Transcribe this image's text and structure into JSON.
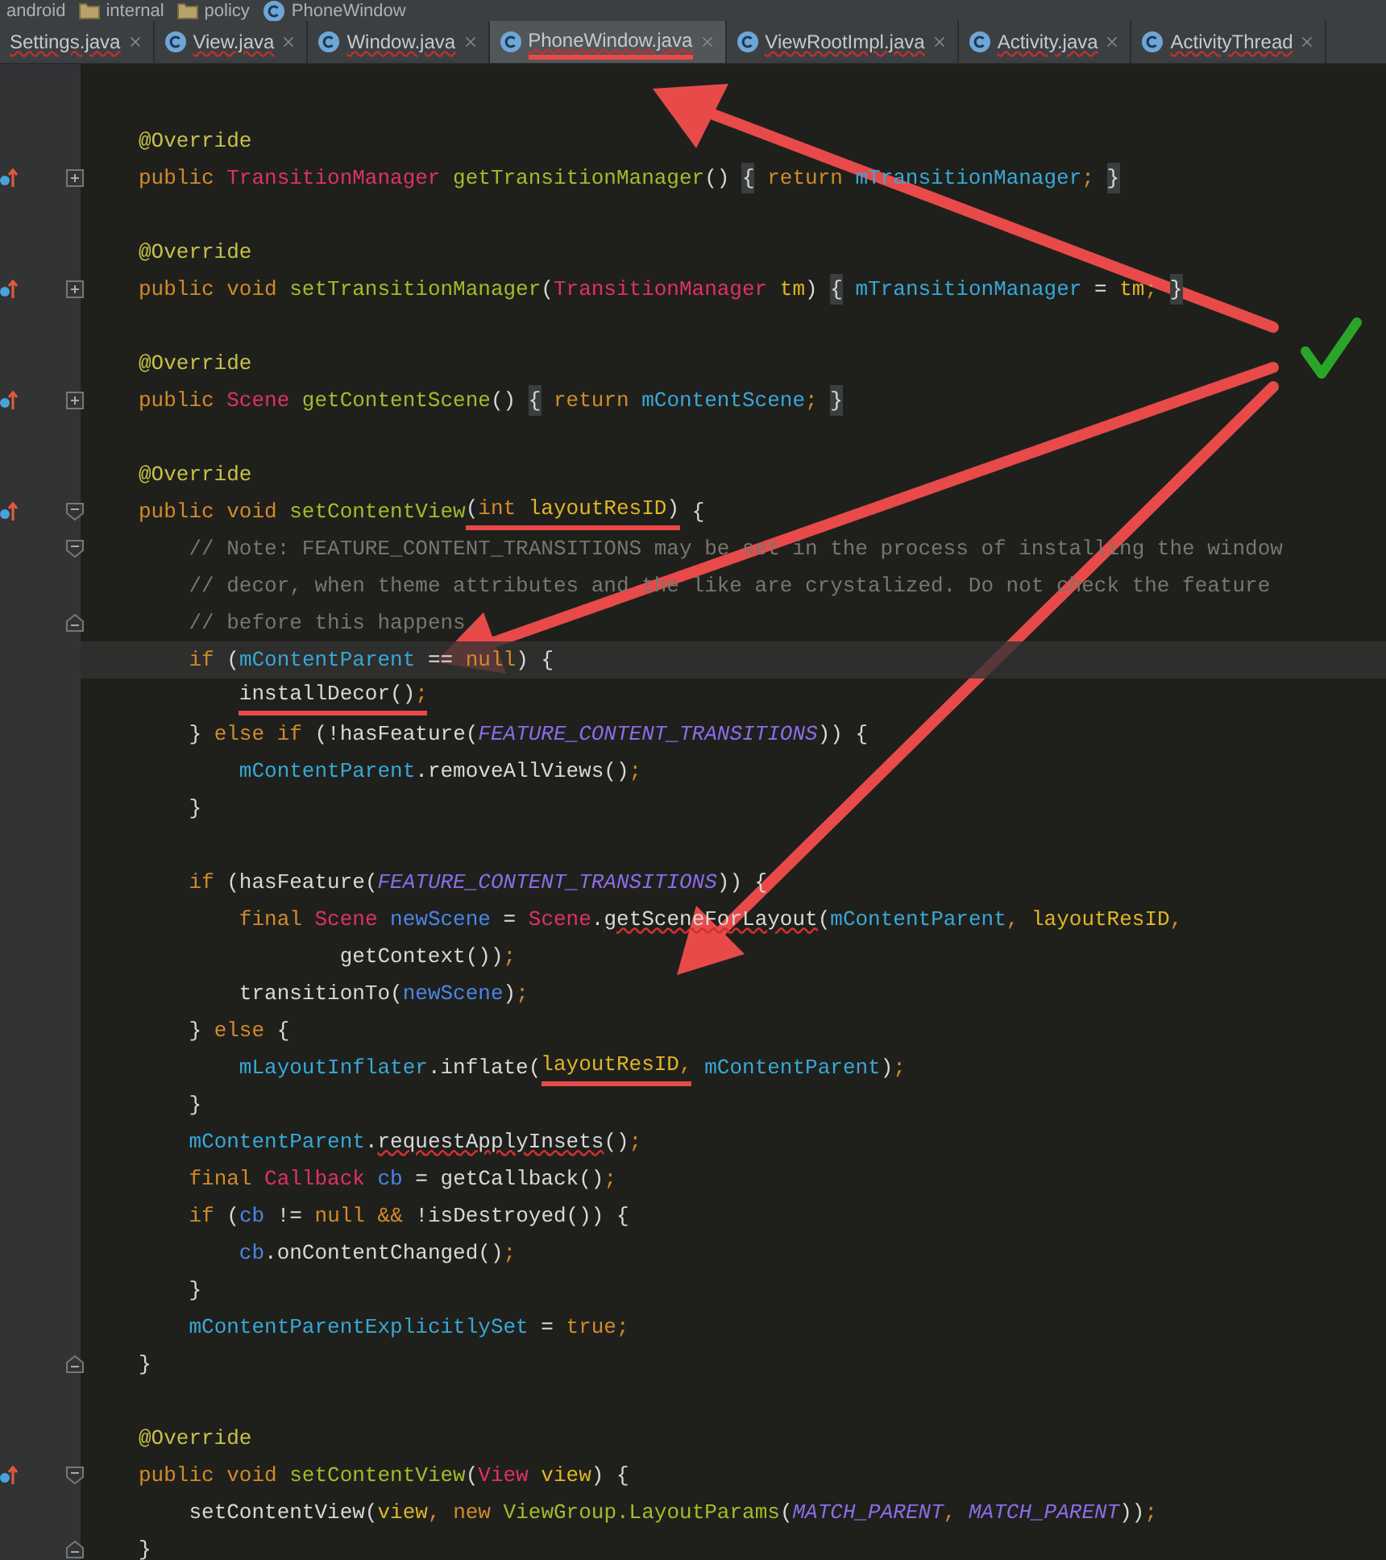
{
  "breadcrumb": [
    {
      "label": "android",
      "kind": "plain"
    },
    {
      "label": "internal",
      "kind": "folder"
    },
    {
      "label": "policy",
      "kind": "folder"
    },
    {
      "label": "PhoneWindow",
      "kind": "class"
    }
  ],
  "tabs": [
    {
      "label": "Settings.java",
      "icon": false,
      "selected": false,
      "marked": false
    },
    {
      "label": "View.java",
      "icon": true,
      "selected": false,
      "marked": false
    },
    {
      "label": "Window.java",
      "icon": true,
      "selected": false,
      "marked": false
    },
    {
      "label": "PhoneWindow.java",
      "icon": true,
      "selected": true,
      "marked": true
    },
    {
      "label": "ViewRootImpl.java",
      "icon": true,
      "selected": false,
      "marked": false
    },
    {
      "label": "Activity.java",
      "icon": true,
      "selected": false,
      "marked": false
    },
    {
      "label": "ActivityThread",
      "icon": true,
      "selected": false,
      "marked": false
    }
  ],
  "code_lines": [
    {
      "kind": "plain",
      "override": false,
      "current": false
    },
    {
      "kind": "plain",
      "override": false,
      "current": false,
      "segs": [
        {
          "text": "@Override",
          "kind": "annot"
        }
      ]
    },
    {
      "kind": "collapsed",
      "override": true,
      "current": false,
      "segs": [
        {
          "text": "public ",
          "kind": "kw"
        },
        {
          "text": "TransitionManager ",
          "kind": "type"
        },
        {
          "text": "getTransitionManager",
          "kind": "method"
        },
        {
          "text": "() ",
          "kind": "plain"
        },
        {
          "text": "{",
          "kind": "fold"
        },
        {
          "text": " return ",
          "kind": "kw"
        },
        {
          "text": "mTransitionManager",
          "kind": "field"
        },
        {
          "text": "; ",
          "kind": "punct"
        },
        {
          "text": "}",
          "kind": "fold"
        }
      ]
    },
    {
      "kind": "plain",
      "override": false,
      "current": false
    },
    {
      "kind": "plain",
      "override": false,
      "current": false,
      "segs": [
        {
          "text": "@Override",
          "kind": "annot"
        }
      ]
    },
    {
      "kind": "collapsed",
      "override": true,
      "current": false,
      "segs": [
        {
          "text": "public void ",
          "kind": "kw"
        },
        {
          "text": "setTransitionManager",
          "kind": "method"
        },
        {
          "text": "(",
          "kind": "plain"
        },
        {
          "text": "TransitionManager ",
          "kind": "type"
        },
        {
          "text": "tm",
          "kind": "param"
        },
        {
          "text": ") ",
          "kind": "plain"
        },
        {
          "text": "{",
          "kind": "fold"
        },
        {
          "text": " mTransitionManager",
          "kind": "field"
        },
        {
          "text": " = ",
          "kind": "plain"
        },
        {
          "text": "tm",
          "kind": "param"
        },
        {
          "text": "; ",
          "kind": "punct"
        },
        {
          "text": "}",
          "kind": "fold"
        }
      ]
    },
    {
      "kind": "plain",
      "override": false,
      "current": false
    },
    {
      "kind": "plain",
      "override": false,
      "current": false,
      "segs": [
        {
          "text": "@Override",
          "kind": "annot"
        }
      ]
    },
    {
      "kind": "collapsed",
      "override": true,
      "current": false,
      "segs": [
        {
          "text": "public ",
          "kind": "kw"
        },
        {
          "text": "Scene ",
          "kind": "type"
        },
        {
          "text": "getContentScene",
          "kind": "method"
        },
        {
          "text": "() ",
          "kind": "plain"
        },
        {
          "text": "{",
          "kind": "fold"
        },
        {
          "text": " return ",
          "kind": "kw"
        },
        {
          "text": "mContentScene",
          "kind": "field"
        },
        {
          "text": "; ",
          "kind": "punct"
        },
        {
          "text": "}",
          "kind": "fold"
        }
      ]
    },
    {
      "kind": "plain",
      "override": false,
      "current": false
    },
    {
      "kind": "plain",
      "override": false,
      "current": false,
      "segs": [
        {
          "text": "@Override",
          "kind": "annot"
        }
      ]
    },
    {
      "kind": "fold-start",
      "override": true,
      "current": false,
      "segs": [
        {
          "text": "public void ",
          "kind": "kw"
        },
        {
          "text": "setContentView",
          "kind": "method"
        },
        {
          "text": "(",
          "kind": "plain",
          "marked": true
        },
        {
          "text": "int ",
          "kind": "kw",
          "marked": true
        },
        {
          "text": "layoutResID",
          "kind": "param",
          "marked": true
        },
        {
          "text": ")",
          "kind": "plain",
          "marked": true
        },
        {
          "text": " {",
          "kind": "plain"
        }
      ]
    },
    {
      "kind": "fold-start",
      "override": false,
      "current": false,
      "segs": [
        {
          "text": "    // Note: FEATURE_CONTENT_TRANSITIONS may be set in the process of installing the window",
          "kind": "comment"
        }
      ]
    },
    {
      "kind": "plain",
      "override": false,
      "current": false,
      "segs": [
        {
          "text": "    // decor, when theme attributes and the like are crystalized. Do not check the feature",
          "kind": "comment"
        }
      ]
    },
    {
      "kind": "fold-end",
      "override": false,
      "current": false,
      "segs": [
        {
          "text": "    // before this happens.",
          "kind": "comment"
        }
      ]
    },
    {
      "kind": "plain",
      "override": false,
      "current": true,
      "segs": [
        {
          "text": "    if ",
          "kind": "kw"
        },
        {
          "text": "(",
          "kind": "plain"
        },
        {
          "text": "mContentParent",
          "kind": "field"
        },
        {
          "text": " == ",
          "kind": "plain"
        },
        {
          "text": "null",
          "kind": "kw"
        },
        {
          "text": ") {",
          "kind": "plain"
        }
      ]
    },
    {
      "kind": "plain",
      "override": false,
      "current": false,
      "segs": [
        {
          "text": "        installDecor()",
          "kind": "plain",
          "marked": true
        },
        {
          "text": ";",
          "kind": "punct",
          "marked": true
        }
      ]
    },
    {
      "kind": "plain",
      "override": false,
      "current": false,
      "segs": [
        {
          "text": "    } ",
          "kind": "plain"
        },
        {
          "text": "else if ",
          "kind": "kw"
        },
        {
          "text": "(!hasFeature(",
          "kind": "plain"
        },
        {
          "text": "FEATURE_CONTENT_TRANSITIONS",
          "kind": "const"
        },
        {
          "text": ")) {",
          "kind": "plain"
        }
      ]
    },
    {
      "kind": "plain",
      "override": false,
      "current": false,
      "segs": [
        {
          "text": "        mContentParent",
          "kind": "field"
        },
        {
          "text": ".removeAllViews()",
          "kind": "plain"
        },
        {
          "text": ";",
          "kind": "punct"
        }
      ]
    },
    {
      "kind": "plain",
      "override": false,
      "current": false,
      "segs": [
        {
          "text": "    }",
          "kind": "plain"
        }
      ]
    },
    {
      "kind": "plain",
      "override": false,
      "current": false
    },
    {
      "kind": "plain",
      "override": false,
      "current": false,
      "segs": [
        {
          "text": "    if ",
          "kind": "kw"
        },
        {
          "text": "(hasFeature(",
          "kind": "plain"
        },
        {
          "text": "FEATURE_CONTENT_TRANSITIONS",
          "kind": "const"
        },
        {
          "text": ")) {",
          "kind": "plain"
        }
      ]
    },
    {
      "kind": "plain",
      "override": false,
      "current": false,
      "segs": [
        {
          "text": "        final ",
          "kind": "kw"
        },
        {
          "text": "Scene ",
          "kind": "type"
        },
        {
          "text": "newScene",
          "kind": "local"
        },
        {
          "text": " = ",
          "kind": "plain"
        },
        {
          "text": "Scene",
          "kind": "type"
        },
        {
          "text": ".",
          "kind": "plain"
        },
        {
          "text": "getSceneForLayout",
          "kind": "unresolved"
        },
        {
          "text": "(",
          "kind": "plain"
        },
        {
          "text": "mContentParent",
          "kind": "field"
        },
        {
          "text": ", ",
          "kind": "punct"
        },
        {
          "text": "layoutResID",
          "kind": "param"
        },
        {
          "text": ",",
          "kind": "punct"
        }
      ]
    },
    {
      "kind": "plain",
      "override": false,
      "current": false,
      "segs": [
        {
          "text": "                getContext())",
          "kind": "plain"
        },
        {
          "text": ";",
          "kind": "punct"
        }
      ]
    },
    {
      "kind": "plain",
      "override": false,
      "current": false,
      "segs": [
        {
          "text": "        transitionTo(",
          "kind": "plain"
        },
        {
          "text": "newScene",
          "kind": "local"
        },
        {
          "text": ")",
          "kind": "plain"
        },
        {
          "text": ";",
          "kind": "punct"
        }
      ]
    },
    {
      "kind": "plain",
      "override": false,
      "current": false,
      "segs": [
        {
          "text": "    } ",
          "kind": "plain"
        },
        {
          "text": "else",
          "kind": "kw"
        },
        {
          "text": " {",
          "kind": "plain"
        }
      ]
    },
    {
      "kind": "plain",
      "override": false,
      "current": false,
      "segs": [
        {
          "text": "        mLayoutInflater",
          "kind": "field"
        },
        {
          "text": ".inflate(",
          "kind": "plain"
        },
        {
          "text": "layoutResID",
          "kind": "param",
          "marked": true
        },
        {
          "text": ",",
          "kind": "punct",
          "marked": true
        },
        {
          "text": " mContentParent",
          "kind": "field"
        },
        {
          "text": ")",
          "kind": "plain"
        },
        {
          "text": ";",
          "kind": "punct"
        }
      ]
    },
    {
      "kind": "plain",
      "override": false,
      "current": false,
      "segs": [
        {
          "text": "    }",
          "kind": "plain"
        }
      ]
    },
    {
      "kind": "plain",
      "override": false,
      "current": false,
      "segs": [
        {
          "text": "    mContentParent",
          "kind": "field"
        },
        {
          "text": ".",
          "kind": "plain"
        },
        {
          "text": "requestApplyInsets",
          "kind": "unresolved"
        },
        {
          "text": "()",
          "kind": "plain"
        },
        {
          "text": ";",
          "kind": "punct"
        }
      ]
    },
    {
      "kind": "plain",
      "override": false,
      "current": false,
      "segs": [
        {
          "text": "    final ",
          "kind": "kw"
        },
        {
          "text": "Callback ",
          "kind": "type"
        },
        {
          "text": "cb",
          "kind": "local"
        },
        {
          "text": " = getCallback()",
          "kind": "plain"
        },
        {
          "text": ";",
          "kind": "punct"
        }
      ]
    },
    {
      "kind": "plain",
      "override": false,
      "current": false,
      "segs": [
        {
          "text": "    if ",
          "kind": "kw"
        },
        {
          "text": "(",
          "kind": "plain"
        },
        {
          "text": "cb",
          "kind": "local"
        },
        {
          "text": " != ",
          "kind": "plain"
        },
        {
          "text": "null && ",
          "kind": "kw"
        },
        {
          "text": "!isDestroyed()) {",
          "kind": "plain"
        }
      ]
    },
    {
      "kind": "plain",
      "override": false,
      "current": false,
      "segs": [
        {
          "text": "        cb",
          "kind": "local"
        },
        {
          "text": ".onContentChanged()",
          "kind": "plain"
        },
        {
          "text": ";",
          "kind": "punct"
        }
      ]
    },
    {
      "kind": "plain",
      "override": false,
      "current": false,
      "segs": [
        {
          "text": "    }",
          "kind": "plain"
        }
      ]
    },
    {
      "kind": "plain",
      "override": false,
      "current": false,
      "segs": [
        {
          "text": "    mContentParentExplicitlySet",
          "kind": "field"
        },
        {
          "text": " = ",
          "kind": "plain"
        },
        {
          "text": "true",
          "kind": "kw"
        },
        {
          "text": ";",
          "kind": "punct"
        }
      ]
    },
    {
      "kind": "fold-end",
      "override": false,
      "current": false,
      "segs": [
        {
          "text": "}",
          "kind": "plain"
        }
      ]
    },
    {
      "kind": "plain",
      "override": false,
      "current": false
    },
    {
      "kind": "plain",
      "override": false,
      "current": false,
      "segs": [
        {
          "text": "@Override",
          "kind": "annot"
        }
      ]
    },
    {
      "kind": "fold-start",
      "override": true,
      "current": false,
      "segs": [
        {
          "text": "public void ",
          "kind": "kw"
        },
        {
          "text": "setContentView",
          "kind": "method"
        },
        {
          "text": "(",
          "kind": "plain"
        },
        {
          "text": "View ",
          "kind": "type"
        },
        {
          "text": "view",
          "kind": "param"
        },
        {
          "text": ") {",
          "kind": "plain"
        }
      ]
    },
    {
      "kind": "plain",
      "override": false,
      "current": false,
      "segs": [
        {
          "text": "    setContentView(",
          "kind": "plain"
        },
        {
          "text": "view",
          "kind": "param"
        },
        {
          "text": ", ",
          "kind": "punct"
        },
        {
          "text": "new ",
          "kind": "kw"
        },
        {
          "text": "ViewGroup.LayoutParams",
          "kind": "method"
        },
        {
          "text": "(",
          "kind": "plain"
        },
        {
          "text": "MATCH_PARENT",
          "kind": "const"
        },
        {
          "text": ", ",
          "kind": "punct"
        },
        {
          "text": "MATCH_PARENT",
          "kind": "const"
        },
        {
          "text": "))",
          "kind": "plain"
        },
        {
          "text": ";",
          "kind": "punct"
        }
      ]
    },
    {
      "kind": "fold-end",
      "override": false,
      "current": false,
      "segs": [
        {
          "text": "}",
          "kind": "plain"
        }
      ]
    }
  ]
}
